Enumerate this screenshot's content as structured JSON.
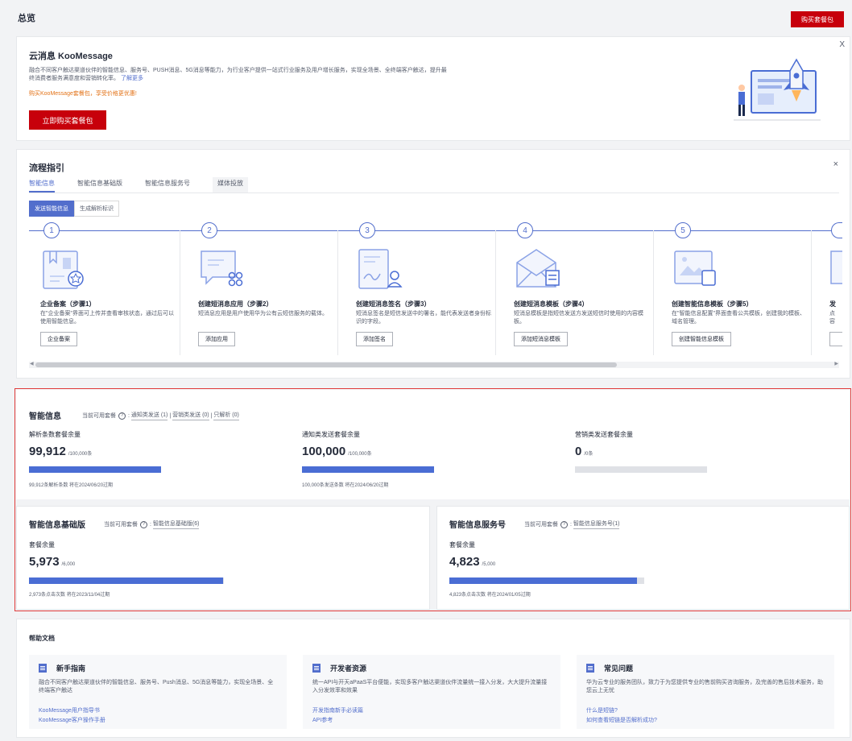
{
  "header": {
    "title": "总览",
    "buy_button": "购买套餐包"
  },
  "banner": {
    "title": "云消息 KooMessage",
    "description": "融合不同客户触达渠道伙伴的智能信息、服务号、PUSH消息、5G消息等能力，为行业客户提供一站式行业服务及用户增长服务，实现全场景、全终端客户触达，提升最终消费者服务满意度和营销转化率。",
    "learn_more": "了解更多",
    "promo": "购买KooMessage套餐包，享受价格更优惠!",
    "buy_button": "立即购买套餐包",
    "close": "X"
  },
  "flow": {
    "title": "流程指引",
    "close": "×",
    "tabs": [
      "智能信息",
      "智能信息基础版",
      "智能信息服务号",
      "媒体投放"
    ],
    "segments": [
      "发送智能信息",
      "生成解析标识"
    ],
    "steps": [
      {
        "num": "1",
        "name": "企业备案（步骤1）",
        "desc": "在\"企业备案\"界面可上传并查看审核状态，通过后可以使用智能信息。",
        "button": "企业备案"
      },
      {
        "num": "2",
        "name": "创建短消息应用（步骤2）",
        "desc": "短消息应用是用户使用华为公有云短信服务的载体。",
        "button": "添加应用"
      },
      {
        "num": "3",
        "name": "创建短消息签名（步骤3）",
        "desc": "短消息签名是短信发送中的署名，能代表发送者身份标识的字段。",
        "button": "添加签名"
      },
      {
        "num": "4",
        "name": "创建短消息模板（步骤4）",
        "desc": "短消息模板是指短信发送方发送短信时使用的内容模板。",
        "button": "添加短消息模板"
      },
      {
        "num": "5",
        "name": "创建智能信息模板（步骤5）",
        "desc": "在\"智能信息配置\"界面查看公共模板，创建我的模板、域名管理。",
        "button": "创建智能信息模板"
      },
      {
        "num": "",
        "name": "发",
        "desc": "点容",
        "button": ""
      }
    ]
  },
  "quota_main": {
    "title": "智能信息",
    "meta_label": "当前可用套餐",
    "meta_help": "?",
    "meta_items": [
      "通知类发送 (1)",
      "营销类发送 (0)",
      "只解析 (0)"
    ],
    "sep": "|",
    "items": [
      {
        "label": "解析条数套餐余量",
        "value": "99,912",
        "unit": "/100,000条",
        "fill": 0.9991,
        "foot": "99,912条解析条数 将在2024/06/20过期"
      },
      {
        "label": "通知类发送套餐余量",
        "value": "100,000",
        "unit": "/100,000条",
        "fill": 1.0,
        "foot": "100,000条发送条数 将在2024/06/20过期"
      },
      {
        "label": "营销类发送套餐余量",
        "value": "0",
        "unit": "/0条",
        "fill": 0,
        "foot": ""
      }
    ]
  },
  "quota_basic": {
    "title": "智能信息基础版",
    "meta_label": "当前可用套餐",
    "meta_help": "?",
    "meta_item": "智能信息基础版(6)",
    "label": "套餐余量",
    "value": "5,973",
    "unit": "/6,000",
    "fill": 0.9955,
    "foot": "2,973条点击次数 将在2023/11/04过期"
  },
  "quota_service": {
    "title": "智能信息服务号",
    "meta_label": "当前可用套餐",
    "meta_help": "?",
    "meta_item": "智能信息服务号(1)",
    "label": "套餐余量",
    "value": "4,823",
    "unit": "/5,000",
    "fill": 0.9646,
    "foot": "4,823条点击次数 将在2024/01/05过期"
  },
  "help": {
    "title": "帮助文档",
    "boxes": [
      {
        "title": "新手指南",
        "desc": "融合不同客户触达渠道伙伴的智能信息、服务号、Push消息、5G消息等能力，实现全场景、全终端客户触达",
        "links": [
          "KooMessage用户指导书",
          "KooMessage客户操作手册"
        ]
      },
      {
        "title": "开发者资源",
        "desc": "统一API与开天aPaaS平台便能，实现多客户触达渠道伙伴流量统一接入分发，大大提升流量接入分发效率和效果",
        "links": [
          "开发指南新手必读篇",
          "API参考"
        ]
      },
      {
        "title": "常见问题",
        "desc": "华为云专业的服务团队，致力于为您提供专业的售前购买咨询服务，及完善的售后技术服务，助您云上无忧",
        "links": [
          "什么是短链?",
          "如何查看短链是否解析成功?"
        ]
      }
    ]
  }
}
